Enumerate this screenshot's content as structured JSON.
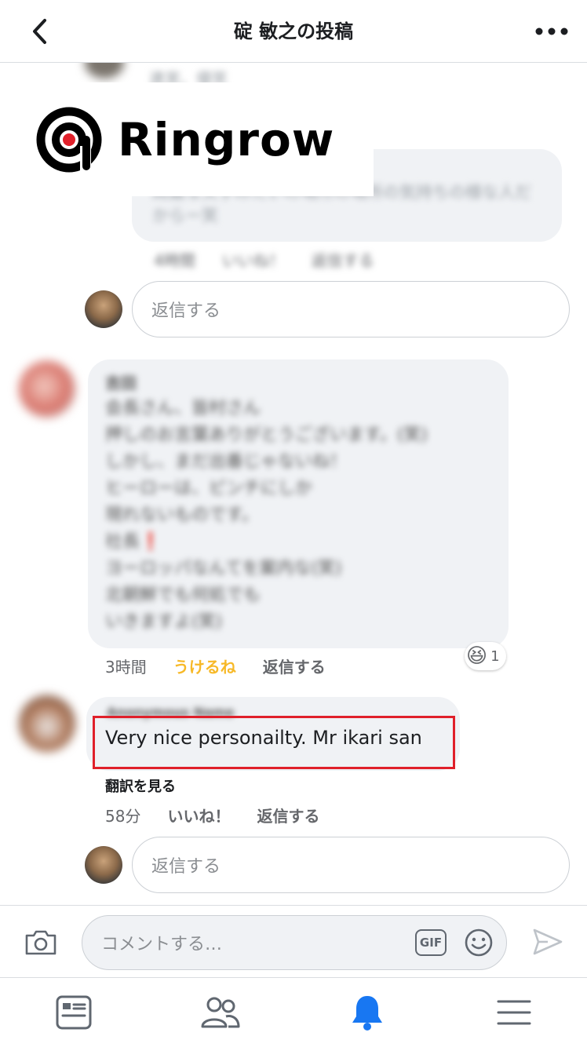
{
  "header": {
    "title": "碇 敏之の投稿"
  },
  "logo": {
    "text": "Ringrow"
  },
  "comments": {
    "first": {
      "blurred_name": "連実、優笑",
      "blurred_body": "綺麗な文字みたいの場所の場所の気持ちの様な人だからー笑",
      "blurred_meta": [
        "4時間",
        "いいね！",
        "返信する"
      ]
    },
    "reply_placeholder_1": "返信する",
    "second": {
      "blurred_name": "吉田",
      "blurred_lines": [
        "会長さん、皆村さん",
        "押しのお言葉ありがとうございます。(笑)",
        "しかし、まだ出番じゃないね！",
        "ヒーローは、ピンチにしか",
        "現れないものです。",
        "社長❗",
        "ヨーロッパなんてを案内な(笑)",
        "北朝鮮でも何処でも",
        "いきますよ(笑)"
      ],
      "time": "3時間",
      "reaction_label": "うけるね",
      "reply": "返信する",
      "reaction_emoji": "😆",
      "reaction_count": "1"
    },
    "third": {
      "blurred_name": "Anonymous Name",
      "text": "Very nice personailty. Mr ikari san",
      "translate": "翻訳を見る",
      "time": "58分",
      "like": "いいね！",
      "reply": "返信する"
    },
    "reply_placeholder_2": "返信する"
  },
  "composer": {
    "placeholder": "コメントする…",
    "gif_label": "GIF"
  },
  "tabs": [
    "news-feed",
    "friends",
    "notifications",
    "menu"
  ],
  "colors": {
    "accent": "#1877f2",
    "haha": "#f7b928",
    "highlight": "#e0202a"
  }
}
